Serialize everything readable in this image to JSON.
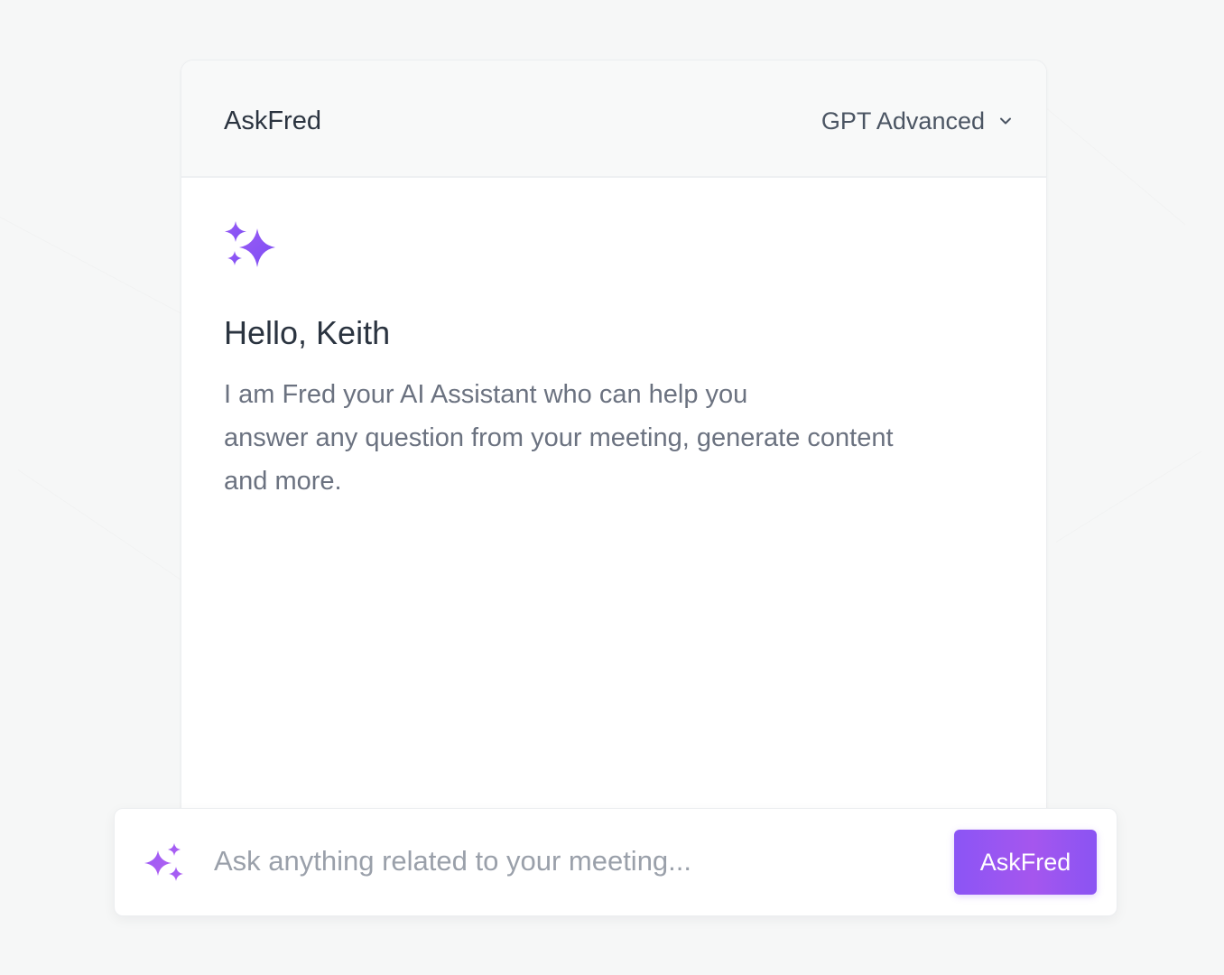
{
  "header": {
    "app_title": "AskFred",
    "model_selector": {
      "selected": "GPT Advanced",
      "icon": "chevron-down-icon"
    }
  },
  "body": {
    "icon": "sparkles-icon",
    "greeting": "Hello, Keith",
    "intro_lines": [
      "I am Fred your AI Assistant who can help you",
      "answer any question from your meeting, generate content",
      "and more."
    ]
  },
  "ask_bar": {
    "icon": "sparkles-icon",
    "placeholder": "Ask anything related to your meeting...",
    "value": "",
    "button_label": "AskFred"
  },
  "colors": {
    "accent": "#8b55f5",
    "accent_light": "#b06cf0",
    "text_dark": "#2b3440",
    "text_muted": "#6b7280",
    "placeholder": "#9aa0aa",
    "background": "#f6f7f7"
  }
}
